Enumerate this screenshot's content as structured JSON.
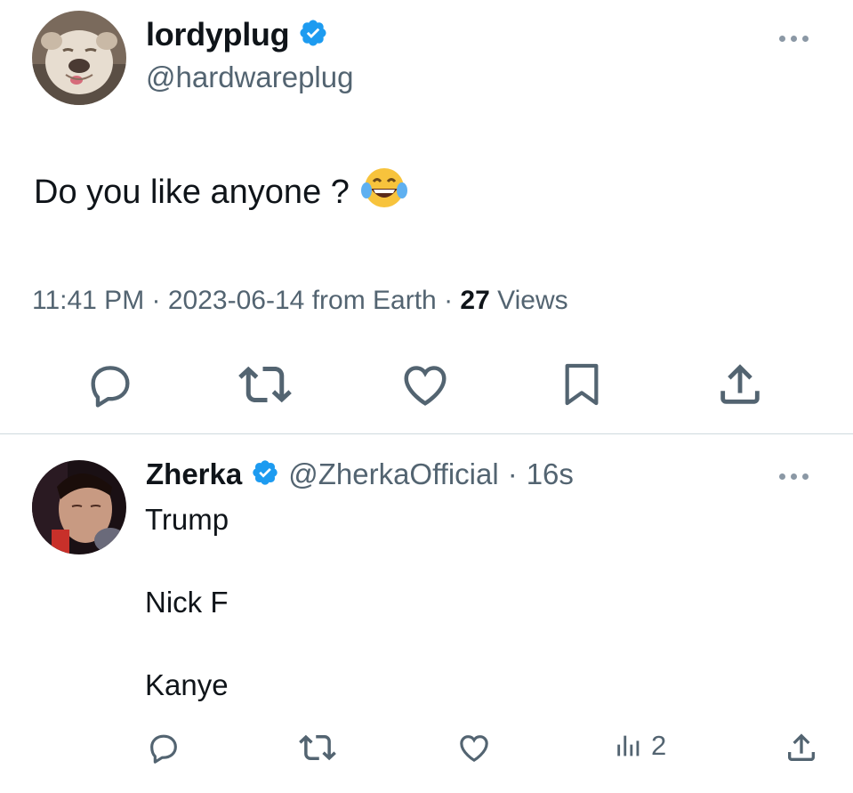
{
  "main_tweet": {
    "display_name": "lordyplug",
    "handle": "@hardwareplug",
    "text": "Do you like anyone ?",
    "emoji": "😂",
    "time": "11:41 PM",
    "date": "2023-06-14",
    "source": "from Earth",
    "views_count": "27",
    "views_label": "Views",
    "separator": "·",
    "avatar_icon": "bulldog-avatar",
    "actions": [
      "reply-icon",
      "retweet-icon",
      "like-icon",
      "bookmark-icon",
      "share-icon"
    ]
  },
  "reply": {
    "display_name": "Zherka",
    "handle": "@ZherkaOfficial",
    "separator": "·",
    "age": "16s",
    "lines": [
      "Trump",
      "Nick F",
      "Kanye"
    ],
    "views_count": "2",
    "avatar_icon": "person-avatar",
    "actions": [
      "reply-icon",
      "retweet-icon",
      "like-icon",
      "views-icon",
      "share-icon"
    ]
  },
  "colors": {
    "text": "#0f1419",
    "secondary": "#536471",
    "verified": "#1d9bf0",
    "divider": "#cfd9de"
  }
}
